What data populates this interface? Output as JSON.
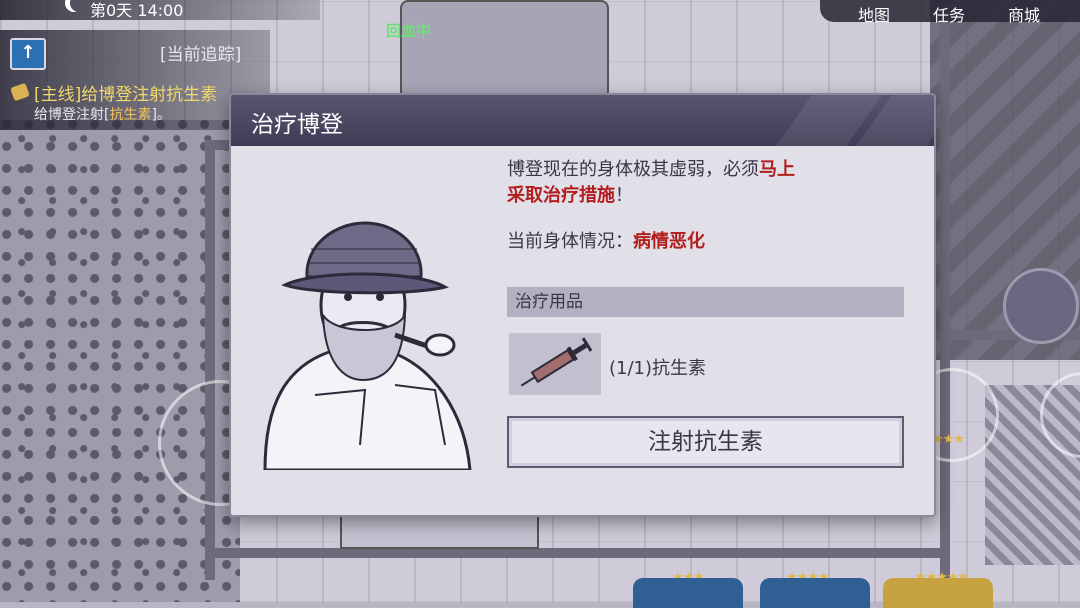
{
  "hud": {
    "day_time": "第0天 14:00",
    "healing_status": "回血中",
    "nav_map": "地图",
    "nav_tasks": "任务",
    "nav_shop": "商城"
  },
  "tracking": {
    "title": "[当前追踪]",
    "quest_main": "[主线]给博登注射抗生素",
    "quest_sub_prefix": "给博登注射[",
    "quest_sub_item": "抗生素",
    "quest_sub_suffix": "]。"
  },
  "dialog": {
    "title": "治疗博登",
    "desc_normal_1": "博登现在的身体极其虚弱，必须",
    "desc_red_1": "马上",
    "desc_red_2": "采取治疗措施",
    "desc_normal_2": "！",
    "condition_label": "当前身体情况：",
    "condition_value": "病情恶化",
    "supplies_header": "治疗用品",
    "item_label": "(1/1)抗生素",
    "inject_button": "注射抗生素"
  },
  "bottom_slots": {
    "slot1_stars": "★★★",
    "slot2_stars": "★★★★",
    "slot3_stars": "★★★★★"
  },
  "side": {
    "ring_stars": "★★★",
    "badge_stars": "★★★★"
  },
  "colors": {
    "header_purple": "#403b55",
    "warning_red": "#b21d1d",
    "quest_gold": "#f0d86a",
    "healing_green": "#6ee07a"
  }
}
